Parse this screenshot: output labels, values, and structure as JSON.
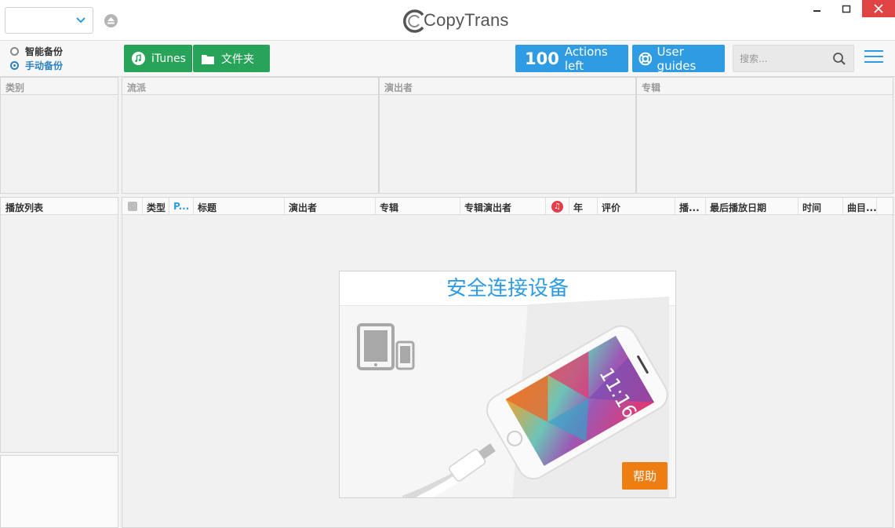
{
  "app": {
    "logo": "CopyTrans"
  },
  "colors": {
    "green": "#27a45a",
    "blue": "#2e9be3",
    "orange": "#ee7e12",
    "close": "#e04343"
  },
  "backup": {
    "smart": "智能备份",
    "manual": "手动备份",
    "selected": "manual"
  },
  "toolbar": {
    "itunes_label": "iTunes",
    "folder_label": "文件夹",
    "actions_count": "100",
    "actions_label": "Actions left",
    "guides_label": "User guides",
    "search_placeholder": "搜索..."
  },
  "panes": {
    "category": "类别",
    "genre": "流派",
    "artist": "演出者",
    "album": "专辑",
    "playlist": "播放列表"
  },
  "track_columns": [
    "类型",
    "P...",
    "标题",
    "演出者",
    "专辑",
    "专辑演出者",
    "年",
    "评价",
    "播...",
    "最后播放日期",
    "时间",
    "曲目..."
  ],
  "connect": {
    "title": "安全连接设备",
    "help": "帮助"
  },
  "icons": [
    "chevron-down-icon",
    "eject-icon",
    "music-note-icon",
    "folder-icon",
    "lifebuoy-icon",
    "search-icon",
    "hamburger-icon",
    "tablet-icon",
    "phone-icon"
  ]
}
